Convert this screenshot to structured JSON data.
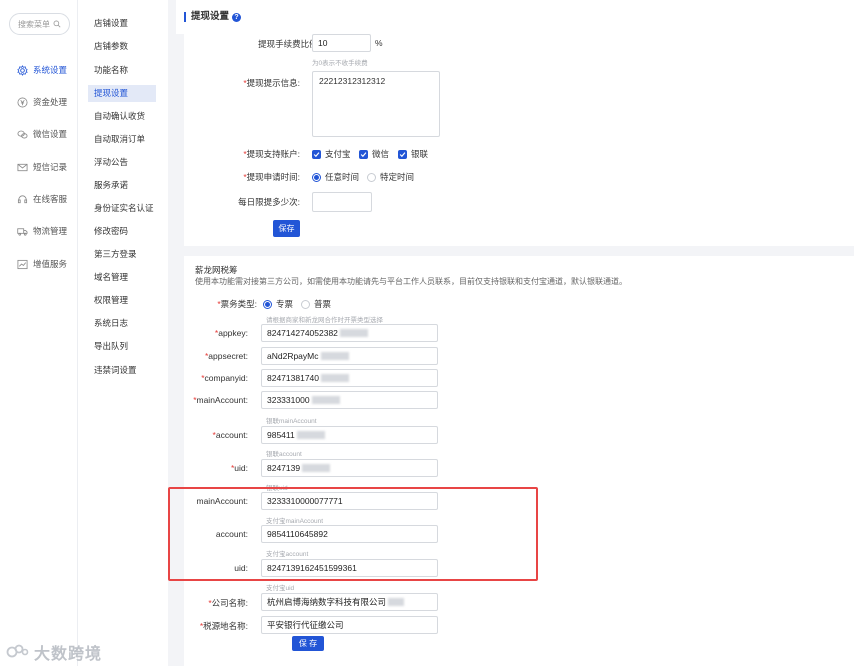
{
  "sidebar": {
    "search_placeholder": "搜索菜单",
    "items": [
      {
        "label": "系统设置",
        "icon": "gear-icon",
        "active": true
      },
      {
        "label": "资金处理",
        "icon": "yen-icon"
      },
      {
        "label": "微信设置",
        "icon": "wechat-icon"
      },
      {
        "label": "短信记录",
        "icon": "mail-icon"
      },
      {
        "label": "在线客服",
        "icon": "headset-icon"
      },
      {
        "label": "物流管理",
        "icon": "truck-icon"
      },
      {
        "label": "增值服务",
        "icon": "chart-icon"
      }
    ]
  },
  "submenu": [
    "店铺设置",
    "店铺参数",
    "功能名称",
    "提现设置",
    "自动确认收货",
    "自动取消订单",
    "浮动公告",
    "服务承诺",
    "身份证实名认证",
    "修改密码",
    "第三方登录",
    "域名管理",
    "权限管理",
    "系统日志",
    "导出队列",
    "违禁词设置"
  ],
  "page_title": "提现设置",
  "withdraw": {
    "fee_label": "提现手续费比例:",
    "fee_value": "10",
    "fee_unit": "%",
    "fee_hint": "为0表示不收手续费",
    "tip_label": "提现提示信息:",
    "tip_value": "22212312312312",
    "accounts_label": "提现支持账户:",
    "accounts": [
      "支付宝",
      "微信",
      "银联"
    ],
    "time_label": "提现申请时间:",
    "time_options": [
      "任意时间",
      "特定时间"
    ],
    "daily_label": "每日限提多少次:",
    "daily_value": "",
    "save_label": "保存"
  },
  "tax": {
    "title": "薪龙网税筹",
    "desc": "使用本功能需对接第三方公司，如需使用本功能请先与平台工作人员联系，目前仅支持银联和支付宝通道，默认银联通道。",
    "ticket_label": "票务类型:",
    "ticket_options": [
      "专票",
      "普票"
    ],
    "ticket_hint": "请根据商家和新龙网合作时开票类型选择",
    "appkey_label": "appkey:",
    "appkey_value": "824714274052382",
    "appsecret_label": "appsecret:",
    "appsecret_value": "aNd2RpayMc",
    "companyid_label": "companyid:",
    "companyid_value": "82471381740",
    "mainaccount_label": "mainAccount:",
    "mainaccount_value": "323331000",
    "mainaccount_hint": "银联mainAccount",
    "account_label": "account:",
    "account_value": "985411",
    "account_hint": "银联account",
    "uid_label": "uid:",
    "uid_value": "8247139",
    "uid_hint": "银联uid",
    "ali_mainaccount_label": "mainAccount:",
    "ali_mainaccount_value": "3233310000077771",
    "ali_mainaccount_hint": "支付宝mainAccount",
    "ali_account_label": "account:",
    "ali_account_value": "9854110645892",
    "ali_account_hint": "支付宝account",
    "ali_uid_label": "uid:",
    "ali_uid_value": "8247139162451599361",
    "ali_uid_hint": "支付宝uid",
    "company_label": "公司名称:",
    "company_value": "杭州启博海纳数字科技有限公司",
    "taxplace_label": "税源地名称:",
    "taxplace_value": "平安银行代征缴公司",
    "save_label": "保 存"
  },
  "watermark": "大数跨境",
  "colors": {
    "accent": "#2255d6",
    "highlight": "#e84545"
  }
}
